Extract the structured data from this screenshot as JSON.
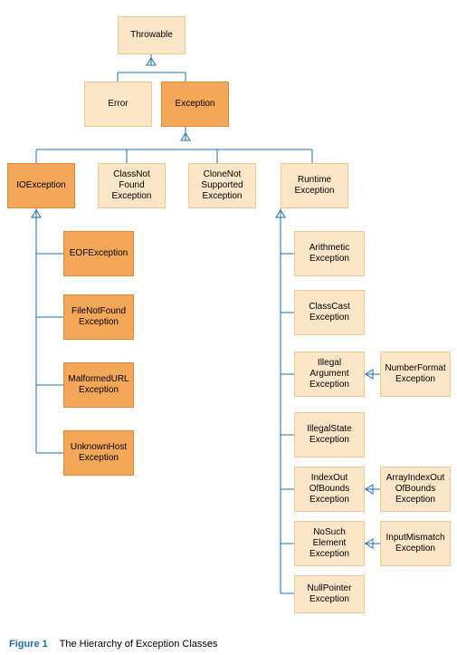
{
  "nodes": {
    "throwable": "Throwable",
    "error": "Error",
    "exception": "Exception",
    "ioexception": "IOException",
    "classnotfound": "ClassNot\nFound\nException",
    "clonenotsupported": "CloneNot\nSupported\nException",
    "runtime": "Runtime\nException",
    "eof": "EOFException",
    "filenotfound": "FileNotFound\nException",
    "malformedurl": "MalformedURL\nException",
    "unknownhost": "UnknownHost\nException",
    "arithmetic": "Arithmetic\nException",
    "classcast": "ClassCast\nException",
    "illegalargument": "Illegal\nArgument\nException",
    "illegalstate": "IllegalState\nException",
    "indexoutofbounds": "IndexOut\nOfBounds\nException",
    "nosuchelement": "NoSuch\nElement\nException",
    "nullpointer": "NullPointer\nException",
    "numberformat": "NumberFormat\nException",
    "arrayindexoutofbounds": "ArrayIndexOut\nOfBounds\nException",
    "inputmismatch": "InputMismatch\nException"
  },
  "caption": {
    "figure": "Figure 1",
    "text": "The Hierarchy of Exception Classes"
  },
  "colors": {
    "dark": "#f5a758",
    "darkBorder": "#e08838",
    "light": "#fde6c8",
    "lightBorder": "#f0c890",
    "line": "#1a6fb0"
  }
}
